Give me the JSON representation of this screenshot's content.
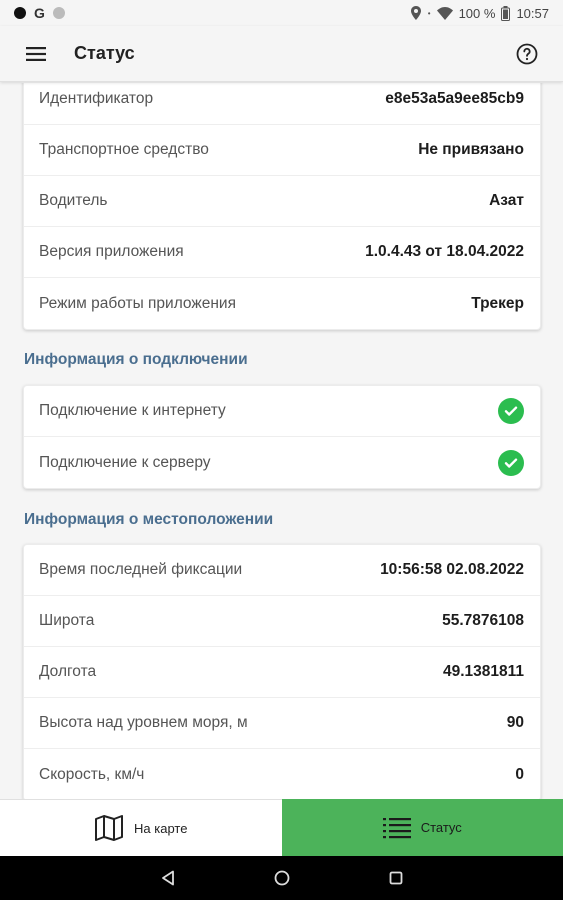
{
  "status_bar": {
    "g_letter": "G",
    "battery": "100 %",
    "time": "10:57"
  },
  "app_bar": {
    "title": "Статус"
  },
  "device_info": {
    "rows": [
      {
        "label": "Идентификатор",
        "value": "e8e53a5a9ee85cb9"
      },
      {
        "label": "Транспортное средство",
        "value": "Не привязано"
      },
      {
        "label": "Водитель",
        "value": "Азат"
      },
      {
        "label": "Версия приложения",
        "value": "1.0.4.43 от 18.04.2022"
      },
      {
        "label": "Режим работы приложения",
        "value": "Трекер"
      }
    ]
  },
  "connection": {
    "title": "Информация о подключении",
    "rows": [
      {
        "label": "Подключение к интернету",
        "icon": "check-circle-icon"
      },
      {
        "label": "Подключение к серверу",
        "icon": "check-circle-icon"
      }
    ]
  },
  "location": {
    "title": "Информация о местоположении",
    "rows": [
      {
        "label": "Время последней фиксации",
        "value": "10:56:58 02.08.2022"
      },
      {
        "label": "Широта",
        "value": "55.7876108"
      },
      {
        "label": "Долгота",
        "value": "49.1381811"
      },
      {
        "label": "Высота над уровнем моря, м",
        "value": "90"
      },
      {
        "label": "Скорость, км/ч",
        "value": "0"
      }
    ]
  },
  "bottom_nav": {
    "map_label": "На карте",
    "status_label": "Статус"
  },
  "colors": {
    "accent": "#4cb35a",
    "check": "#2bbd4f",
    "section_title": "#4a6e8f"
  }
}
